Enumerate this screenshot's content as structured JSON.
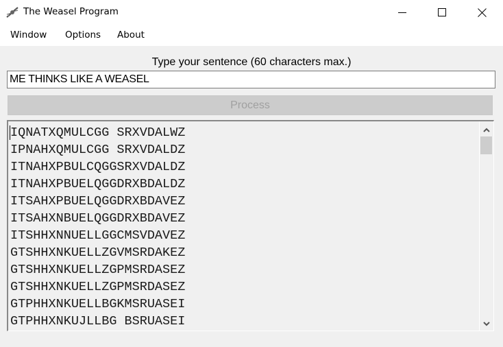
{
  "window": {
    "title": "The Weasel Program",
    "icon": "dna-icon",
    "controls": {
      "minimize": "minimize-icon",
      "maximize": "maximize-icon",
      "close": "close-icon"
    }
  },
  "menu": {
    "items": [
      {
        "label": "Window"
      },
      {
        "label": "Options"
      },
      {
        "label": "About"
      }
    ]
  },
  "form": {
    "prompt": "Type your sentence (60 characters max.)",
    "sentence_value": "ME THINKS LIKE A WEASEL",
    "process_label": "Process",
    "process_enabled": false
  },
  "output": {
    "lines": [
      "IQNATXQMULCGG SRXVDALWZ",
      "IPNAHXQMULCGG SRXVDALDZ",
      "ITNAHXPBULCQGGSRXVDALDZ",
      "ITNAHXPBUELQGGDRXBDALDZ",
      "ITSAHXPBUELQGGDRXBDAVEZ",
      "ITSAHXNBUELQGGDRXBDAVEZ",
      "ITSHHXNNUELLGGCMSVDAVEZ",
      "GTSHHXNKUELLZGVMSRDAKEZ",
      "GTSHHXNKUELLZGPMSRDASEZ",
      "GTSHHXNKUELLZGPMSRDASEZ",
      "GTPHHXNKUELLBGKMSRUASEI",
      "GTPHHXNKUJLLBG BSRUASEI"
    ],
    "scroll": {
      "up": "chevron-up-icon",
      "down": "chevron-down-icon"
    }
  }
}
